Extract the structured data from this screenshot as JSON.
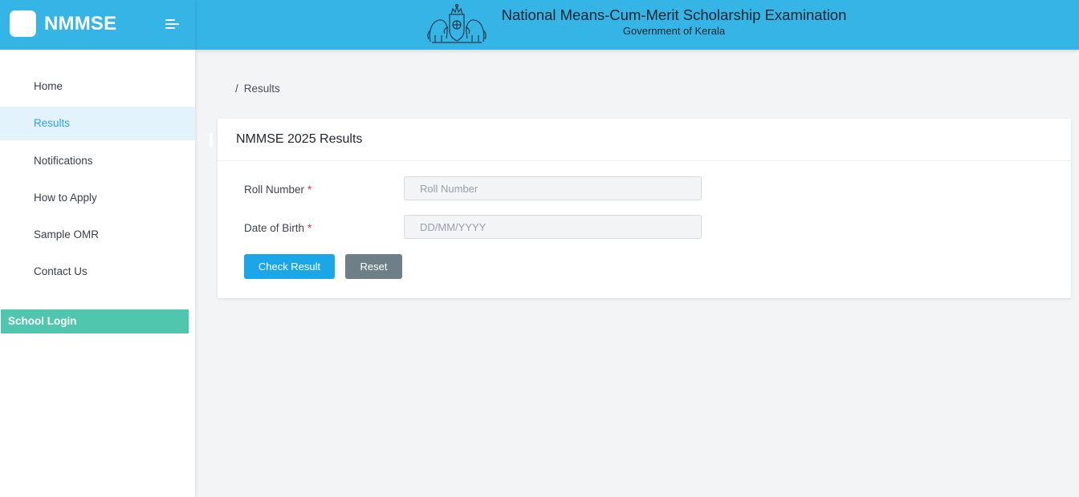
{
  "brand": {
    "name": "NMMSE"
  },
  "header": {
    "title": "National Means-Cum-Merit Scholarship Examination",
    "subtitle": "Government of Kerala"
  },
  "sidebar": {
    "items": [
      {
        "label": "Home",
        "active": false
      },
      {
        "label": "Results",
        "active": true
      },
      {
        "label": "Notifications",
        "active": false
      },
      {
        "label": "How to Apply",
        "active": false
      },
      {
        "label": "Sample OMR",
        "active": false
      },
      {
        "label": "Contact Us",
        "active": false
      }
    ],
    "school_login": "School Login"
  },
  "breadcrumb": {
    "separator": "/",
    "current": "Results"
  },
  "card": {
    "title": "NMMSE 2025 Results",
    "fields": [
      {
        "label": "Roll Number",
        "required_mark": "*",
        "placeholder": "Roll Number",
        "value": ""
      },
      {
        "label": "Date of Birth",
        "required_mark": "*",
        "placeholder": "DD/MM/YYYY",
        "value": ""
      }
    ],
    "buttons": {
      "submit": "Check Result",
      "reset": "Reset"
    }
  },
  "colors": {
    "header": "#35b5e6",
    "active_nav_bg": "#e3f3fb",
    "active_nav_text": "#2ba4d8",
    "school_login": "#4fc6ad",
    "primary_button": "#1ba6e8",
    "secondary_button": "#6e7f88",
    "required": "#e2302c"
  },
  "icons": {
    "menu": "menu-toggle-icon",
    "emblem": "kerala-emblem-icon",
    "logo": "app-logo-icon"
  }
}
